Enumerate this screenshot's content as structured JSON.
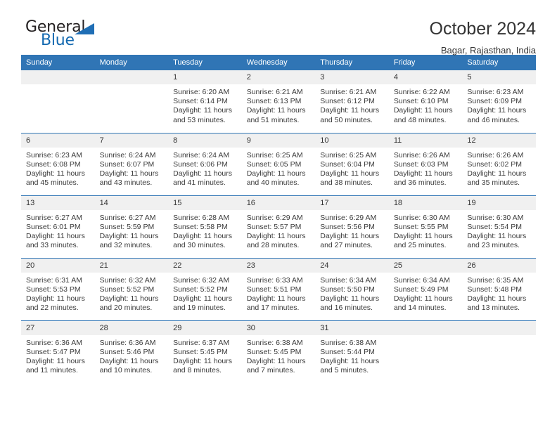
{
  "brand": {
    "name_top": "General",
    "name_bottom": "Blue",
    "accent_color": "#1f6eb5"
  },
  "header": {
    "title": "October 2024",
    "subtitle": "Bagar, Rajasthan, India"
  },
  "colors": {
    "header_row_bg": "#3075b5",
    "day_number_bg": "#f0f0f0",
    "text": "#333333"
  },
  "weekday_headers": [
    "Sunday",
    "Monday",
    "Tuesday",
    "Wednesday",
    "Thursday",
    "Friday",
    "Saturday"
  ],
  "weeks": [
    [
      {
        "day": "",
        "sunrise": "",
        "sunset": "",
        "daylight_line1": "",
        "daylight_line2": "",
        "blank": true
      },
      {
        "day": "",
        "sunrise": "",
        "sunset": "",
        "daylight_line1": "",
        "daylight_line2": "",
        "blank": true
      },
      {
        "day": "1",
        "sunrise": "Sunrise: 6:20 AM",
        "sunset": "Sunset: 6:14 PM",
        "daylight_line1": "Daylight: 11 hours",
        "daylight_line2": "and 53 minutes."
      },
      {
        "day": "2",
        "sunrise": "Sunrise: 6:21 AM",
        "sunset": "Sunset: 6:13 PM",
        "daylight_line1": "Daylight: 11 hours",
        "daylight_line2": "and 51 minutes."
      },
      {
        "day": "3",
        "sunrise": "Sunrise: 6:21 AM",
        "sunset": "Sunset: 6:12 PM",
        "daylight_line1": "Daylight: 11 hours",
        "daylight_line2": "and 50 minutes."
      },
      {
        "day": "4",
        "sunrise": "Sunrise: 6:22 AM",
        "sunset": "Sunset: 6:10 PM",
        "daylight_line1": "Daylight: 11 hours",
        "daylight_line2": "and 48 minutes."
      },
      {
        "day": "5",
        "sunrise": "Sunrise: 6:23 AM",
        "sunset": "Sunset: 6:09 PM",
        "daylight_line1": "Daylight: 11 hours",
        "daylight_line2": "and 46 minutes."
      }
    ],
    [
      {
        "day": "6",
        "sunrise": "Sunrise: 6:23 AM",
        "sunset": "Sunset: 6:08 PM",
        "daylight_line1": "Daylight: 11 hours",
        "daylight_line2": "and 45 minutes."
      },
      {
        "day": "7",
        "sunrise": "Sunrise: 6:24 AM",
        "sunset": "Sunset: 6:07 PM",
        "daylight_line1": "Daylight: 11 hours",
        "daylight_line2": "and 43 minutes."
      },
      {
        "day": "8",
        "sunrise": "Sunrise: 6:24 AM",
        "sunset": "Sunset: 6:06 PM",
        "daylight_line1": "Daylight: 11 hours",
        "daylight_line2": "and 41 minutes."
      },
      {
        "day": "9",
        "sunrise": "Sunrise: 6:25 AM",
        "sunset": "Sunset: 6:05 PM",
        "daylight_line1": "Daylight: 11 hours",
        "daylight_line2": "and 40 minutes."
      },
      {
        "day": "10",
        "sunrise": "Sunrise: 6:25 AM",
        "sunset": "Sunset: 6:04 PM",
        "daylight_line1": "Daylight: 11 hours",
        "daylight_line2": "and 38 minutes."
      },
      {
        "day": "11",
        "sunrise": "Sunrise: 6:26 AM",
        "sunset": "Sunset: 6:03 PM",
        "daylight_line1": "Daylight: 11 hours",
        "daylight_line2": "and 36 minutes."
      },
      {
        "day": "12",
        "sunrise": "Sunrise: 6:26 AM",
        "sunset": "Sunset: 6:02 PM",
        "daylight_line1": "Daylight: 11 hours",
        "daylight_line2": "and 35 minutes."
      }
    ],
    [
      {
        "day": "13",
        "sunrise": "Sunrise: 6:27 AM",
        "sunset": "Sunset: 6:01 PM",
        "daylight_line1": "Daylight: 11 hours",
        "daylight_line2": "and 33 minutes."
      },
      {
        "day": "14",
        "sunrise": "Sunrise: 6:27 AM",
        "sunset": "Sunset: 5:59 PM",
        "daylight_line1": "Daylight: 11 hours",
        "daylight_line2": "and 32 minutes."
      },
      {
        "day": "15",
        "sunrise": "Sunrise: 6:28 AM",
        "sunset": "Sunset: 5:58 PM",
        "daylight_line1": "Daylight: 11 hours",
        "daylight_line2": "and 30 minutes."
      },
      {
        "day": "16",
        "sunrise": "Sunrise: 6:29 AM",
        "sunset": "Sunset: 5:57 PM",
        "daylight_line1": "Daylight: 11 hours",
        "daylight_line2": "and 28 minutes."
      },
      {
        "day": "17",
        "sunrise": "Sunrise: 6:29 AM",
        "sunset": "Sunset: 5:56 PM",
        "daylight_line1": "Daylight: 11 hours",
        "daylight_line2": "and 27 minutes."
      },
      {
        "day": "18",
        "sunrise": "Sunrise: 6:30 AM",
        "sunset": "Sunset: 5:55 PM",
        "daylight_line1": "Daylight: 11 hours",
        "daylight_line2": "and 25 minutes."
      },
      {
        "day": "19",
        "sunrise": "Sunrise: 6:30 AM",
        "sunset": "Sunset: 5:54 PM",
        "daylight_line1": "Daylight: 11 hours",
        "daylight_line2": "and 23 minutes."
      }
    ],
    [
      {
        "day": "20",
        "sunrise": "Sunrise: 6:31 AM",
        "sunset": "Sunset: 5:53 PM",
        "daylight_line1": "Daylight: 11 hours",
        "daylight_line2": "and 22 minutes."
      },
      {
        "day": "21",
        "sunrise": "Sunrise: 6:32 AM",
        "sunset": "Sunset: 5:52 PM",
        "daylight_line1": "Daylight: 11 hours",
        "daylight_line2": "and 20 minutes."
      },
      {
        "day": "22",
        "sunrise": "Sunrise: 6:32 AM",
        "sunset": "Sunset: 5:52 PM",
        "daylight_line1": "Daylight: 11 hours",
        "daylight_line2": "and 19 minutes."
      },
      {
        "day": "23",
        "sunrise": "Sunrise: 6:33 AM",
        "sunset": "Sunset: 5:51 PM",
        "daylight_line1": "Daylight: 11 hours",
        "daylight_line2": "and 17 minutes."
      },
      {
        "day": "24",
        "sunrise": "Sunrise: 6:34 AM",
        "sunset": "Sunset: 5:50 PM",
        "daylight_line1": "Daylight: 11 hours",
        "daylight_line2": "and 16 minutes."
      },
      {
        "day": "25",
        "sunrise": "Sunrise: 6:34 AM",
        "sunset": "Sunset: 5:49 PM",
        "daylight_line1": "Daylight: 11 hours",
        "daylight_line2": "and 14 minutes."
      },
      {
        "day": "26",
        "sunrise": "Sunrise: 6:35 AM",
        "sunset": "Sunset: 5:48 PM",
        "daylight_line1": "Daylight: 11 hours",
        "daylight_line2": "and 13 minutes."
      }
    ],
    [
      {
        "day": "27",
        "sunrise": "Sunrise: 6:36 AM",
        "sunset": "Sunset: 5:47 PM",
        "daylight_line1": "Daylight: 11 hours",
        "daylight_line2": "and 11 minutes."
      },
      {
        "day": "28",
        "sunrise": "Sunrise: 6:36 AM",
        "sunset": "Sunset: 5:46 PM",
        "daylight_line1": "Daylight: 11 hours",
        "daylight_line2": "and 10 minutes."
      },
      {
        "day": "29",
        "sunrise": "Sunrise: 6:37 AM",
        "sunset": "Sunset: 5:45 PM",
        "daylight_line1": "Daylight: 11 hours",
        "daylight_line2": "and 8 minutes."
      },
      {
        "day": "30",
        "sunrise": "Sunrise: 6:38 AM",
        "sunset": "Sunset: 5:45 PM",
        "daylight_line1": "Daylight: 11 hours",
        "daylight_line2": "and 7 minutes."
      },
      {
        "day": "31",
        "sunrise": "Sunrise: 6:38 AM",
        "sunset": "Sunset: 5:44 PM",
        "daylight_line1": "Daylight: 11 hours",
        "daylight_line2": "and 5 minutes."
      },
      {
        "day": "",
        "sunrise": "",
        "sunset": "",
        "daylight_line1": "",
        "daylight_line2": "",
        "blank": true
      },
      {
        "day": "",
        "sunrise": "",
        "sunset": "",
        "daylight_line1": "",
        "daylight_line2": "",
        "blank": true
      }
    ]
  ]
}
